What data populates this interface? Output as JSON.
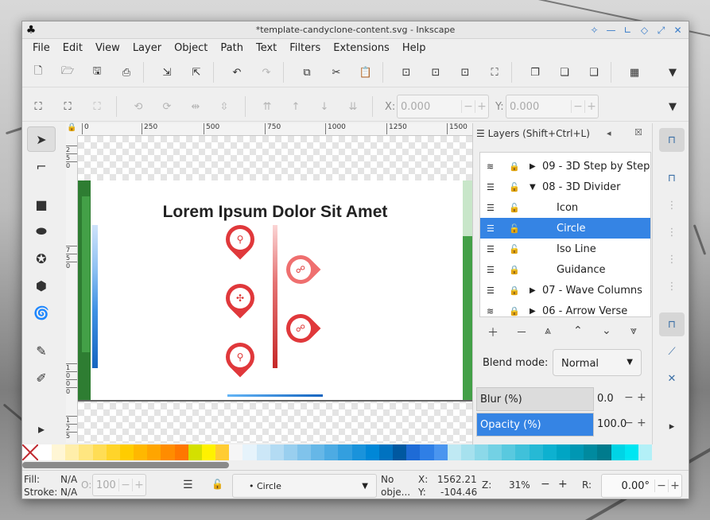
{
  "window": {
    "title": "*template-candyclone-content.svg - Inkscape"
  },
  "menu": [
    "File",
    "Edit",
    "View",
    "Layer",
    "Object",
    "Path",
    "Text",
    "Filters",
    "Extensions",
    "Help"
  ],
  "toolbar2": {
    "x_label": "X:",
    "x_value": "0.000",
    "y_label": "Y:",
    "y_value": "0.000"
  },
  "ruler_top": [
    "0",
    "250",
    "500",
    "750",
    "1000",
    "1250",
    "1500"
  ],
  "ruler_left": [
    "2",
    "5",
    "0",
    "7",
    "5",
    "0",
    "1",
    "0",
    "0",
    "0",
    "1",
    "2",
    "5",
    "0"
  ],
  "canvas": {
    "heading": "Lorem Ipsum Dolor Sit Amet"
  },
  "layers_panel": {
    "header": "Layers (Shift+Ctrl+L)",
    "items": [
      {
        "name": "09 - 3D Step by Step",
        "arrow": "▶"
      },
      {
        "name": "08 - 3D Divider",
        "arrow": "▼"
      },
      {
        "name": "Icon",
        "arrow": ""
      },
      {
        "name": "Circle",
        "arrow": ""
      },
      {
        "name": "Iso Line",
        "arrow": ""
      },
      {
        "name": "Guidance",
        "arrow": ""
      },
      {
        "name": "07 - Wave Columns",
        "arrow": "▶"
      },
      {
        "name": "06 - Arrow Verse",
        "arrow": "▶"
      }
    ],
    "selected": "Circle",
    "blend_label": "Blend mode:",
    "blend_value": "Normal",
    "blur_label": "Blur (%)",
    "blur_value": "0.0",
    "opacity_label": "Opacity (%)",
    "opacity_value": "100.0"
  },
  "status": {
    "fill_label": "Fill:",
    "fill_value": "N/A",
    "stroke_label": "Stroke:",
    "stroke_value": "N/A",
    "o_label": "O:",
    "o_value": "100",
    "layer_name": "• Circle",
    "message_1": "No",
    "message_2": "obje...",
    "x_label": "X:",
    "x_value": "1562.21",
    "y_label": "Y:",
    "y_value": "-104.46",
    "zoom_label": "Z:",
    "zoom_value": "31%",
    "rot_label": "R:",
    "rot_value": "0.00°"
  },
  "palette": [
    "#ffffff",
    "#fff6d5",
    "#ffeeaa",
    "#ffe680",
    "#ffdd55",
    "#ffd42a",
    "#ffcc00",
    "#ffb800",
    "#ffa500",
    "#ff8c00",
    "#ff7700",
    "#d4e000",
    "#fff200",
    "#ffcc33",
    "#f6f6f6",
    "#e6f3fb",
    "#cce7f7",
    "#b3dbf3",
    "#99cfef",
    "#80c3eb",
    "#66b7e7",
    "#4dabe3",
    "#339fdf",
    "#1a93db",
    "#0087d7",
    "#0072c0",
    "#0058a0",
    "#1e6bd6",
    "#2f7fe6",
    "#4a95ef",
    "#bfe9f3",
    "#a6e1ee",
    "#8cd9e9",
    "#73d1e4",
    "#59c9df",
    "#40c1da",
    "#26b9d5",
    "#0db1d0",
    "#00a5c4",
    "#0097b3",
    "#008a9f",
    "#007b8d",
    "#00d4e5",
    "#00e6f2",
    "#b3f0f7",
    "#c0c0c0"
  ]
}
